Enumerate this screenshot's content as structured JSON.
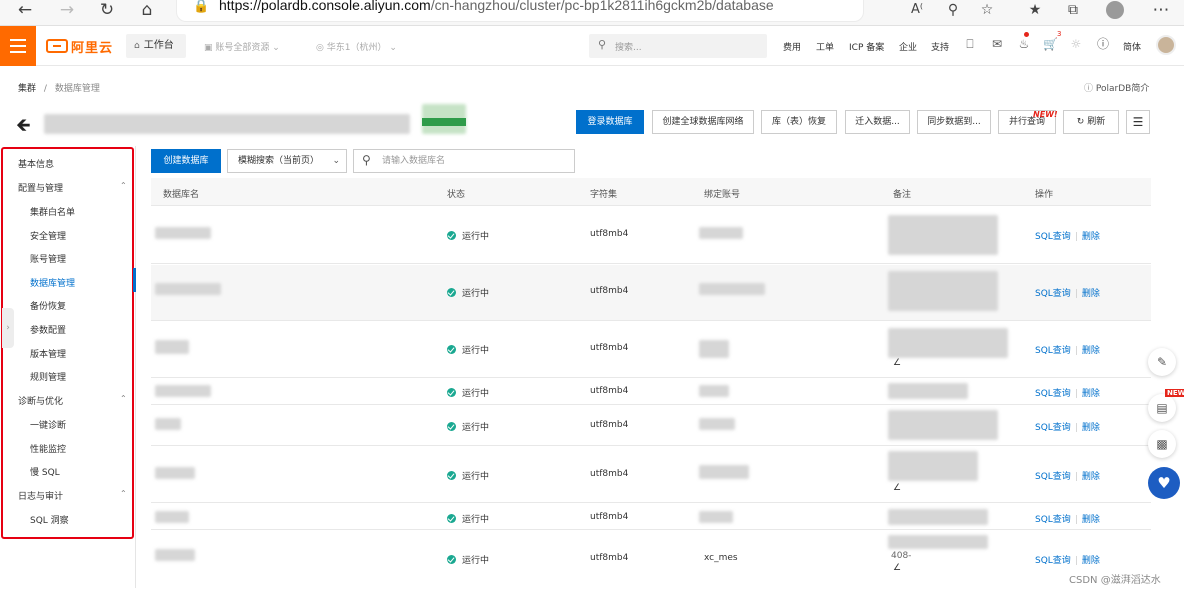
{
  "browser": {
    "back_icon": "arrow-left",
    "forward_icon": "arrow-right",
    "reload_icon": "reload",
    "home_icon": "home",
    "url_host": "https://polardb.console.aliyun.com",
    "url_path": "/cn-hangzhou/cluster/pc-bp1k2811ih6gckm2b/database"
  },
  "topnav": {
    "logo_text": "阿里云",
    "workbench": "工作台",
    "account_group": "账号全部资源",
    "region": "华东1（杭州）",
    "search_placeholder": "搜索...",
    "links": [
      "费用",
      "工单",
      "ICP 备案",
      "企业",
      "支持"
    ],
    "cart_badge": "3",
    "lang": "简体"
  },
  "breadcrumb": {
    "root": "集群",
    "separator": "/",
    "current": "数据库管理"
  },
  "intro_link": "PolarDB简介",
  "header_buttons": {
    "login_db": "登录数据库",
    "create_global": "创建全球数据库网络",
    "restore": "库（表）恢复",
    "migrate_in": "迁入数据...",
    "sync": "同步数据到...",
    "parallel_query": "并行查询",
    "new_badge": "NEW!",
    "refresh": "刷新"
  },
  "sidebar": {
    "basic_info": "基本信息",
    "groups": [
      {
        "label": "配置与管理",
        "items": [
          "集群白名单",
          "安全管理",
          "账号管理",
          "数据库管理",
          "备份恢复",
          "参数配置",
          "版本管理",
          "规则管理"
        ]
      },
      {
        "label": "诊断与优化",
        "items": [
          "一键诊断",
          "性能监控",
          "慢 SQL"
        ]
      },
      {
        "label": "日志与审计",
        "items": [
          "SQL 洞察"
        ]
      }
    ],
    "active": "数据库管理"
  },
  "toolbar": {
    "create_db": "创建数据库",
    "search_mode": "模糊搜索（当前页）",
    "search_placeholder": "请输入数据库名"
  },
  "table": {
    "columns": [
      "数据库名",
      "状态",
      "字符集",
      "绑定账号",
      "备注",
      "操作"
    ],
    "rows": [
      {
        "status": "运行中",
        "charset": "utf8mb4",
        "account": "",
        "action_query": "SQL查询",
        "action_delete": "删除"
      },
      {
        "status": "运行中",
        "charset": "utf8mb4",
        "account": "",
        "action_query": "SQL查询",
        "action_delete": "删除"
      },
      {
        "status": "运行中",
        "charset": "utf8mb4",
        "account": "",
        "action_query": "SQL查询",
        "action_delete": "删除"
      },
      {
        "status": "运行中",
        "charset": "utf8mb4",
        "account": "",
        "action_query": "SQL查询",
        "action_delete": "删除"
      },
      {
        "status": "运行中",
        "charset": "utf8mb4",
        "account": "",
        "action_query": "SQL查询",
        "action_delete": "删除"
      },
      {
        "status": "运行中",
        "charset": "utf8mb4",
        "account": "",
        "action_query": "SQL查询",
        "action_delete": "删除"
      },
      {
        "status": "运行中",
        "charset": "utf8mb4",
        "account": "",
        "action_query": "SQL查询",
        "action_delete": "删除"
      },
      {
        "status": "运行中",
        "charset": "utf8mb4",
        "account": "xc_mes",
        "remark_partial": "408-",
        "action_query": "SQL查询",
        "action_delete": "删除"
      }
    ]
  },
  "floating_tools": {
    "new_badge": "NEW"
  },
  "watermark": "CSDN @滋湃滔达水",
  "colors": {
    "brand": "#ff6a00",
    "primary": "#0070cc",
    "highlight_frame": "#e60012",
    "running": "#1aa891"
  }
}
